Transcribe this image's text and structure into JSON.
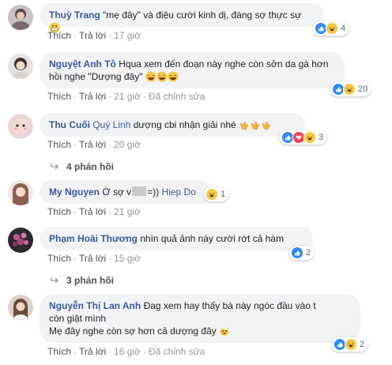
{
  "actions": {
    "like": "Thích",
    "reply": "Trả lời",
    "edited": "Đã chỉnh sửa"
  },
  "comments": [
    {
      "name": "Thuỳ Trang",
      "text": "\"mẹ đây\" và điệu cười kinh dị, đáng sợ thực sự",
      "time": "17 giờ",
      "reactions": [
        "like",
        "haha"
      ],
      "reaction_count": "4"
    },
    {
      "name": "Nguyệt Anh Tô",
      "text_line1": "Hqua xem đến đoạn này nghe còn sởn da gà hơn",
      "text_line2": "hồi nghe \"Dượng đây\"",
      "time": "21 giờ",
      "edited": true,
      "reactions": [
        "like",
        "haha"
      ],
      "reaction_count": "20"
    },
    {
      "name": "Thu Cuối",
      "tag": "Quý Linh",
      "text": "dượng cbi nhận giải nhé",
      "time": "20 giờ",
      "reactions": [
        "like",
        "love",
        "haha"
      ],
      "reaction_count": "3",
      "replies_label": "4 phản hồi"
    },
    {
      "name": "My Nguyen",
      "text_before": "Ờ sợ v",
      "text_after": "=))",
      "tag": "Hiep Do",
      "time": "21 giờ",
      "reactions": [
        "haha"
      ],
      "reaction_count": "1"
    },
    {
      "name": "Phạm Hoài Thương",
      "text": "nhìn quả ảnh này cười rớt cả hàm",
      "time": "15 giờ",
      "reactions": [
        "like"
      ],
      "reaction_count": "2",
      "replies_label": "3 phản hồi"
    },
    {
      "name": "Nguyễn Thị Lan Anh",
      "text_line1": "Đag xem hay thấy bà này ngóc đầu vào t",
      "text_line2": "còn giật mình",
      "text_line3": "Mẹ đây nghe còn sợ hơn cả dượng đây",
      "time": "16 giờ",
      "edited": true,
      "reactions": [
        "like",
        "haha"
      ],
      "reaction_count": "2"
    }
  ],
  "colors": {
    "name_blue": "#385898",
    "bubble_bg": "#f2f3f5",
    "meta_gray": "#90949c",
    "like_blue": "#2e89ff",
    "haha_yellow": "#f7c844",
    "love_red": "#f33e58"
  }
}
